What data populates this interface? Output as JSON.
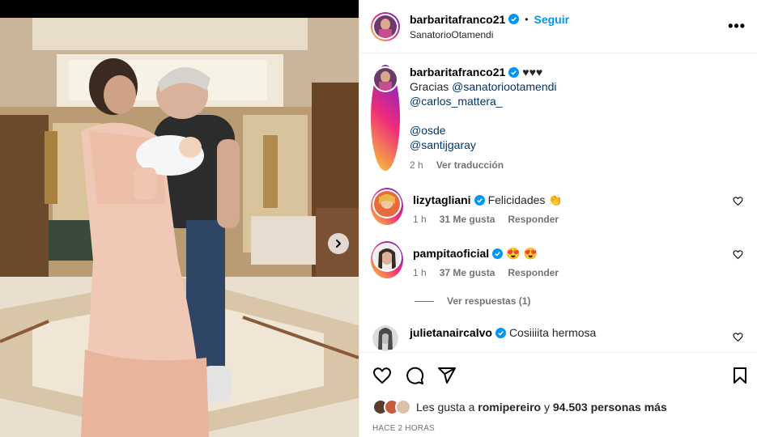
{
  "header": {
    "username": "barbaritafranco21",
    "separator": "•",
    "follow_label": "Seguir",
    "location": "SanatorioOtamendi",
    "more_label": "•••"
  },
  "caption": {
    "username": "barbaritafranco21",
    "hearts": "♥♥♥",
    "line1_prefix": "Gracias",
    "mention1": "@sanatoriootamendi",
    "mention2": "@carlos_mattera_",
    "mention3": "@osde",
    "mention4": "@santijgaray",
    "time": "2 h",
    "translate_label": "Ver traducción"
  },
  "comments": [
    {
      "username": "lizytagliani",
      "text": "Felicidades 👏",
      "time": "1 h",
      "likes": "31 Me gusta",
      "reply_label": "Responder"
    },
    {
      "username": "pampitaoficial",
      "text": "😍 😍",
      "time": "1 h",
      "likes": "37 Me gusta",
      "reply_label": "Responder"
    },
    {
      "username": "julietanaircalvo",
      "text": "Cosiiiita hermosa"
    }
  ],
  "view_replies_label": "Ver respuestas (1)",
  "likes": {
    "prefix": "Les gusta a",
    "user": "romipereiro",
    "connector": "y",
    "count": "94.503 personas más"
  },
  "posted": "HACE 2 HORAS",
  "colors": {
    "accent": "#0095f6",
    "verified": "#0095f6",
    "mention": "#00376b"
  }
}
